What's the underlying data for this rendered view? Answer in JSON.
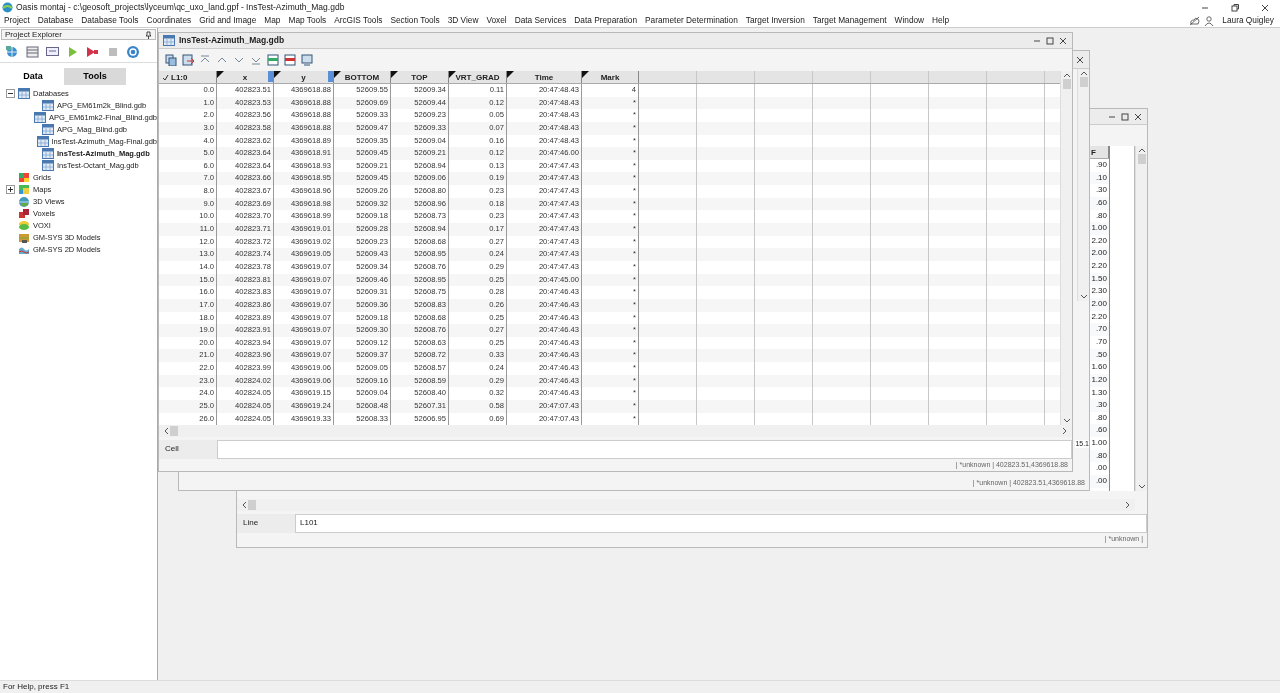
{
  "app_title": "Oasis montaj - c:\\geosoft_projects\\lyceum\\qc_uxo_land.gpf - InsTest-Azimuth_Mag.gdb",
  "menu": [
    "Project",
    "Database",
    "Database Tools",
    "Coordinates",
    "Grid and Image",
    "Map",
    "Map Tools",
    "ArcGIS Tools",
    "Section Tools",
    "3D View",
    "Voxel",
    "Data Services",
    "Data Preparation",
    "Parameter Determination",
    "Target Inversion",
    "Target Management",
    "Window",
    "Help"
  ],
  "user_name": "Laura Quigley",
  "project_explorer": {
    "title": "Project Explorer",
    "tabs": [
      {
        "label": "Data",
        "selected": true
      },
      {
        "label": "Tools",
        "selected": false
      }
    ],
    "tree": [
      {
        "label": "Databases",
        "kind": "database",
        "expanded": true,
        "selected": false,
        "children": [
          {
            "label": "APG_EM61m2k_Blind.gdb",
            "kind": "database",
            "selected": false
          },
          {
            "label": "APG_EM61mk2-Final_Blind.gdb",
            "kind": "database",
            "selected": false
          },
          {
            "label": "APG_Mag_Blind.gdb",
            "kind": "database",
            "selected": false
          },
          {
            "label": "InsTest-Azimuth_Mag-Final.gdb",
            "kind": "database",
            "selected": false
          },
          {
            "label": "InsTest-Azimuth_Mag.gdb",
            "kind": "database",
            "selected": true
          },
          {
            "label": "InsTest-Octant_Mag.gdb",
            "kind": "database",
            "selected": false
          }
        ]
      },
      {
        "label": "Grids",
        "kind": "grid",
        "selected": false
      },
      {
        "label": "Maps",
        "kind": "map",
        "expanded": false,
        "selected": false
      },
      {
        "label": "3D Views",
        "kind": "view3d",
        "selected": false
      },
      {
        "label": "Voxels",
        "kind": "voxel",
        "selected": false
      },
      {
        "label": "VOXI",
        "kind": "voxi",
        "selected": false
      },
      {
        "label": "GM-SYS 3D Models",
        "kind": "model3d",
        "selected": false
      },
      {
        "label": "GM-SYS 2D Models",
        "kind": "model2d",
        "selected": false
      }
    ]
  },
  "back_window": {
    "column_header": "F",
    "values": [
      ".90",
      ".10",
      ".30",
      ".60",
      ".80",
      "1.00",
      "2.20",
      "2.00",
      "2.20",
      "1.50",
      "2.30",
      "2.00",
      "2.20",
      ".70",
      ".70",
      ".50",
      "1.60",
      "1.20",
      "1.30",
      ".30",
      ".80",
      ".60",
      "1.00",
      ".80",
      ".00",
      ".00"
    ],
    "line_label": "Line",
    "line_value": "L101",
    "status": "| *unknown |"
  },
  "middle_window": {
    "fragment": "15.1",
    "status": "| *unknown | 402823.51,4369618.88"
  },
  "main_window": {
    "title": "InsTest-Azimuth_Mag.gdb",
    "columns": [
      {
        "label": "L1:0",
        "kind": "index"
      },
      {
        "label": "x",
        "kind": "coordinate"
      },
      {
        "label": "y",
        "kind": "coordinate"
      },
      {
        "label": "BOTTOM",
        "kind": "channel"
      },
      {
        "label": "TOP",
        "kind": "channel"
      },
      {
        "label": "VRT_GRAD",
        "kind": "channel"
      },
      {
        "label": "Time",
        "kind": "channel"
      },
      {
        "label": "Mark",
        "kind": "channel"
      }
    ],
    "rows": [
      [
        "0.0",
        "402823.51",
        "4369618.88",
        "52609.55",
        "52609.34",
        "0.11",
        "20:47:48.43",
        "4"
      ],
      [
        "1.0",
        "402823.53",
        "4369618.88",
        "52609.69",
        "52609.44",
        "0.12",
        "20:47:48.43",
        "*"
      ],
      [
        "2.0",
        "402823.56",
        "4369618.88",
        "52609.33",
        "52609.23",
        "0.05",
        "20:47:48.43",
        "*"
      ],
      [
        "3.0",
        "402823.58",
        "4369618.88",
        "52609.47",
        "52609.33",
        "0.07",
        "20:47:48.43",
        "*"
      ],
      [
        "4.0",
        "402823.62",
        "4369618.89",
        "52609.35",
        "52609.04",
        "0.16",
        "20:47:48.43",
        "*"
      ],
      [
        "5.0",
        "402823.64",
        "4369618.91",
        "52609.45",
        "52609.21",
        "0.12",
        "20:47:46.00",
        "*"
      ],
      [
        "6.0",
        "402823.64",
        "4369618.93",
        "52609.21",
        "52608.94",
        "0.13",
        "20:47:47.43",
        "*"
      ],
      [
        "7.0",
        "402823.66",
        "4369618.95",
        "52609.45",
        "52609.06",
        "0.19",
        "20:47:47.43",
        "*"
      ],
      [
        "8.0",
        "402823.67",
        "4369618.96",
        "52609.26",
        "52608.80",
        "0.23",
        "20:47:47.43",
        "*"
      ],
      [
        "9.0",
        "402823.69",
        "4369618.98",
        "52609.32",
        "52608.96",
        "0.18",
        "20:47:47.43",
        "*"
      ],
      [
        "10.0",
        "402823.70",
        "4369618.99",
        "52609.18",
        "52608.73",
        "0.23",
        "20:47:47.43",
        "*"
      ],
      [
        "11.0",
        "402823.71",
        "4369619.01",
        "52609.28",
        "52608.94",
        "0.17",
        "20:47:47.43",
        "*"
      ],
      [
        "12.0",
        "402823.72",
        "4369619.02",
        "52609.23",
        "52608.68",
        "0.27",
        "20:47:47.43",
        "*"
      ],
      [
        "13.0",
        "402823.74",
        "4369619.05",
        "52609.43",
        "52608.95",
        "0.24",
        "20:47:47.43",
        "*"
      ],
      [
        "14.0",
        "402823.78",
        "4369619.07",
        "52609.34",
        "52608.76",
        "0.29",
        "20:47:47.43",
        "*"
      ],
      [
        "15.0",
        "402823.81",
        "4369619.07",
        "52609.46",
        "52608.95",
        "0.25",
        "20:47:45.00",
        "*"
      ],
      [
        "16.0",
        "402823.83",
        "4369619.07",
        "52609.31",
        "52608.75",
        "0.28",
        "20:47:46.43",
        "*"
      ],
      [
        "17.0",
        "402823.86",
        "4369619.07",
        "52609.36",
        "52608.83",
        "0.26",
        "20:47:46.43",
        "*"
      ],
      [
        "18.0",
        "402823.89",
        "4369619.07",
        "52609.18",
        "52608.68",
        "0.25",
        "20:47:46.43",
        "*"
      ],
      [
        "19.0",
        "402823.91",
        "4369619.07",
        "52609.30",
        "52608.76",
        "0.27",
        "20:47:46.43",
        "*"
      ],
      [
        "20.0",
        "402823.94",
        "4369619.07",
        "52609.12",
        "52608.63",
        "0.25",
        "20:47:46.43",
        "*"
      ],
      [
        "21.0",
        "402823.96",
        "4369619.07",
        "52609.37",
        "52608.72",
        "0.33",
        "20:47:46.43",
        "*"
      ],
      [
        "22.0",
        "402823.99",
        "4369619.06",
        "52609.05",
        "52608.57",
        "0.24",
        "20:47:46.43",
        "*"
      ],
      [
        "23.0",
        "402824.02",
        "4369619.06",
        "52609.16",
        "52608.59",
        "0.29",
        "20:47:46.43",
        "*"
      ],
      [
        "24.0",
        "402824.05",
        "4369619.15",
        "52609.04",
        "52608.40",
        "0.32",
        "20:47:46.43",
        "*"
      ],
      [
        "25.0",
        "402824.05",
        "4369619.24",
        "52608.48",
        "52607.31",
        "0.58",
        "20:47:07.43",
        "*"
      ],
      [
        "26.0",
        "402824.05",
        "4369619.33",
        "52608.33",
        "52606.95",
        "0.69",
        "20:47:07.43",
        "*"
      ]
    ],
    "cell_label": "Cell",
    "status": "| *unknown | 402823.51,4369618.88"
  },
  "status_bar": "For Help, press F1"
}
